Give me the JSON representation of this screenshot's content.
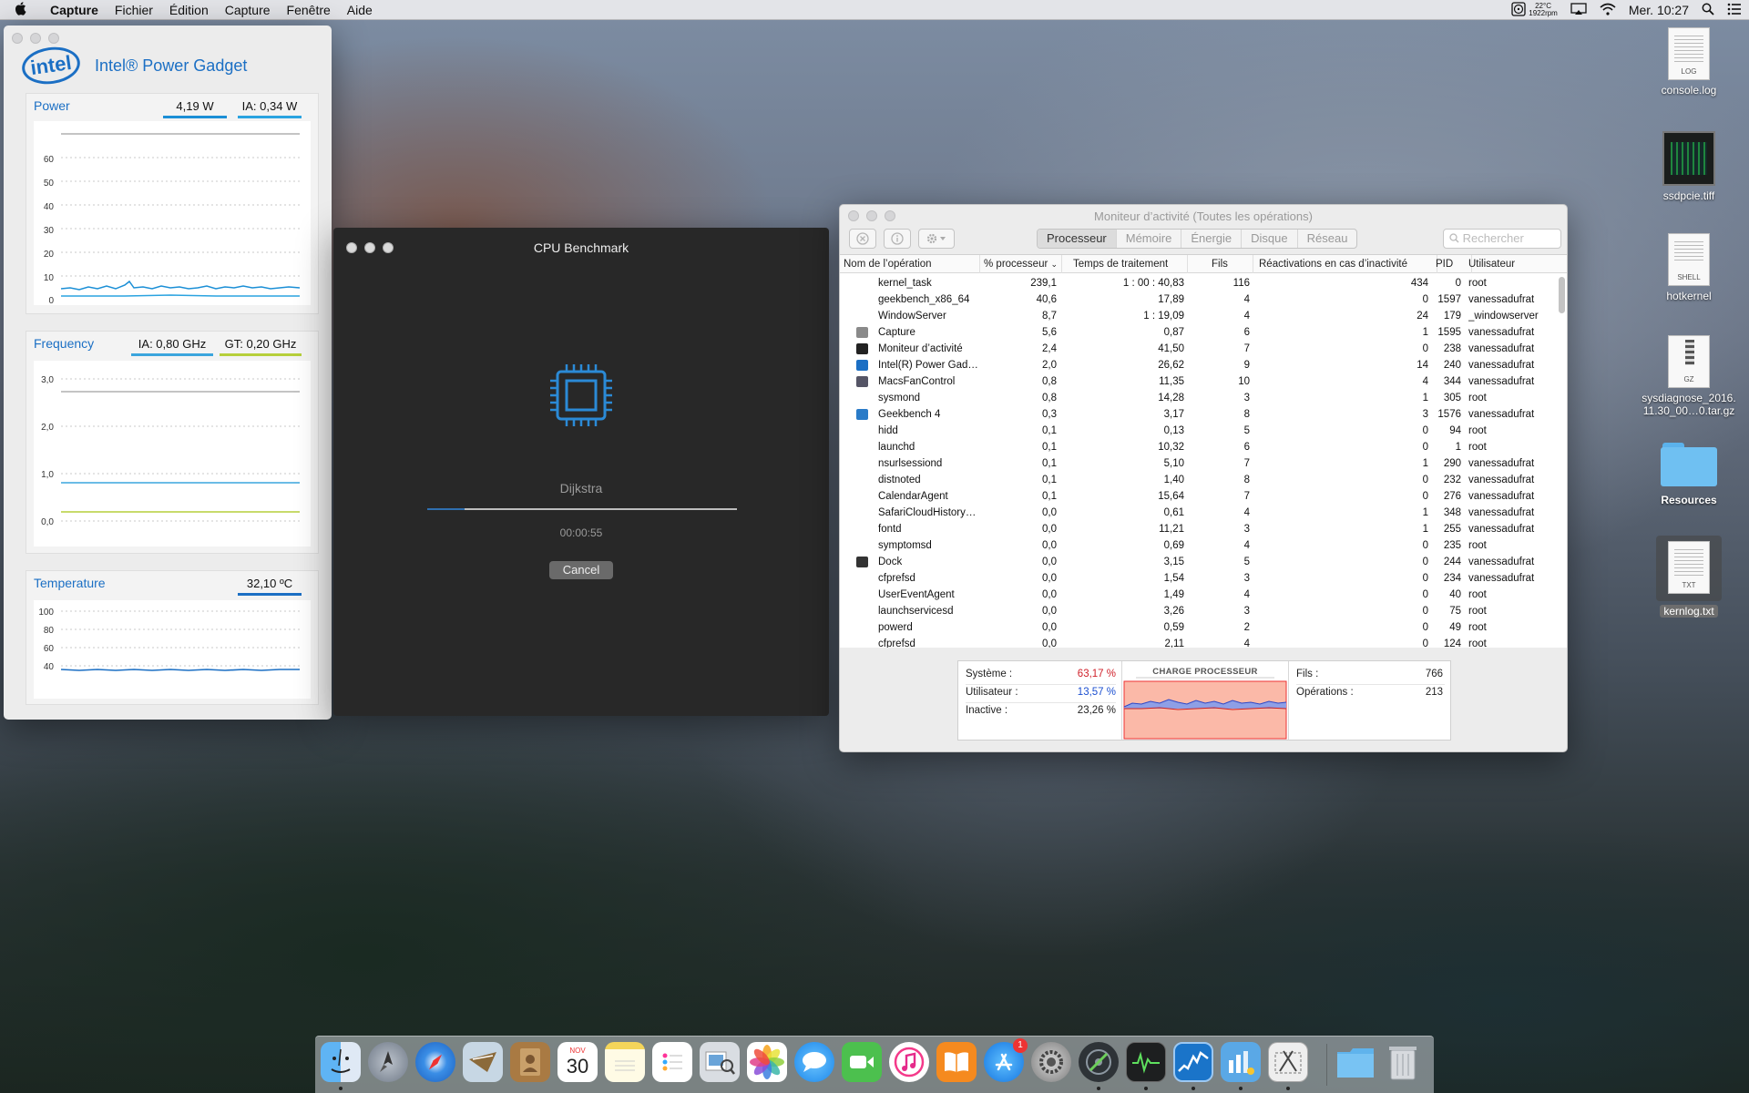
{
  "menubar": {
    "apple": "",
    "items": [
      "Capture",
      "Fichier",
      "Édition",
      "Capture",
      "Fenêtre",
      "Aide"
    ],
    "fan_temp": "22°C",
    "fan_rpm": "1922rpm",
    "clock": "Mer. 10:27"
  },
  "power_gadget": {
    "title": "Intel® Power Gadget",
    "logo": "intel",
    "power": {
      "label": "Power",
      "value1": "4,19 W",
      "value2": "IA: 0,34 W",
      "y_ticks": [
        "60",
        "50",
        "40",
        "30",
        "20",
        "10",
        "0"
      ],
      "series1_color": "#1b8fd6",
      "series2_color": "#2aa3e0"
    },
    "frequency": {
      "label": "Frequency",
      "value1": "IA: 0,80 GHz",
      "value2": "GT: 0,20 GHz",
      "y_ticks": [
        "3,0",
        "2,0",
        "1,0",
        "0,0"
      ],
      "ia_color": "#3aa5dd",
      "gt_color": "#b6cf3a"
    },
    "temperature": {
      "label": "Temperature",
      "value": "32,10 ºC",
      "y_ticks": [
        "100",
        "80",
        "60",
        "40"
      ],
      "series_color": "#1b6fc4"
    }
  },
  "benchmark": {
    "title": "CPU Benchmark",
    "task": "Dijkstra",
    "progress": 0.12,
    "elapsed": "00:00:55",
    "cancel": "Cancel"
  },
  "activity_monitor": {
    "title": "Moniteur d’activité (Toutes les opérations)",
    "tabs": [
      "Processeur",
      "Mémoire",
      "Énergie",
      "Disque",
      "Réseau"
    ],
    "active_tab": "Processeur",
    "search_placeholder": "Rechercher",
    "columns": [
      "Nom de l’opération",
      "% processeur",
      "Temps de traitement",
      "Fils",
      "Réactivations en cas d’inactivité",
      "PID",
      "Utilisateur"
    ],
    "rows": [
      {
        "name": "kernel_task",
        "cpu": "239,1",
        "time": "1 : 00 : 40,83",
        "threads": "116",
        "wakes": "434",
        "pid": "0",
        "user": "root",
        "icon": ""
      },
      {
        "name": "geekbench_x86_64",
        "cpu": "40,6",
        "time": "17,89",
        "threads": "4",
        "wakes": "0",
        "pid": "1597",
        "user": "vanessadufrat",
        "icon": ""
      },
      {
        "name": "WindowServer",
        "cpu": "8,7",
        "time": "1 : 19,09",
        "threads": "4",
        "wakes": "24",
        "pid": "179",
        "user": "_windowserver",
        "icon": ""
      },
      {
        "name": "Capture",
        "cpu": "5,6",
        "time": "0,87",
        "threads": "6",
        "wakes": "1",
        "pid": "1595",
        "user": "vanessadufrat",
        "icon": "#8a8a8a"
      },
      {
        "name": "Moniteur d’activité",
        "cpu": "2,4",
        "time": "41,50",
        "threads": "7",
        "wakes": "0",
        "pid": "238",
        "user": "vanessadufrat",
        "icon": "#222"
      },
      {
        "name": "Intel(R) Power Gad…",
        "cpu": "2,0",
        "time": "26,62",
        "threads": "9",
        "wakes": "14",
        "pid": "240",
        "user": "vanessadufrat",
        "icon": "#1b6fc4"
      },
      {
        "name": "MacsFanControl",
        "cpu": "0,8",
        "time": "11,35",
        "threads": "10",
        "wakes": "4",
        "pid": "344",
        "user": "vanessadufrat",
        "icon": "#556"
      },
      {
        "name": "sysmond",
        "cpu": "0,8",
        "time": "14,28",
        "threads": "3",
        "wakes": "1",
        "pid": "305",
        "user": "root",
        "icon": ""
      },
      {
        "name": "Geekbench 4",
        "cpu": "0,3",
        "time": "3,17",
        "threads": "8",
        "wakes": "3",
        "pid": "1576",
        "user": "vanessadufrat",
        "icon": "#2a7bc8"
      },
      {
        "name": "hidd",
        "cpu": "0,1",
        "time": "0,13",
        "threads": "5",
        "wakes": "0",
        "pid": "94",
        "user": "root",
        "icon": ""
      },
      {
        "name": "launchd",
        "cpu": "0,1",
        "time": "10,32",
        "threads": "6",
        "wakes": "0",
        "pid": "1",
        "user": "root",
        "icon": ""
      },
      {
        "name": "nsurlsessiond",
        "cpu": "0,1",
        "time": "5,10",
        "threads": "7",
        "wakes": "1",
        "pid": "290",
        "user": "vanessadufrat",
        "icon": ""
      },
      {
        "name": "distnoted",
        "cpu": "0,1",
        "time": "1,40",
        "threads": "8",
        "wakes": "0",
        "pid": "232",
        "user": "vanessadufrat",
        "icon": ""
      },
      {
        "name": "CalendarAgent",
        "cpu": "0,1",
        "time": "15,64",
        "threads": "7",
        "wakes": "0",
        "pid": "276",
        "user": "vanessadufrat",
        "icon": ""
      },
      {
        "name": "SafariCloudHistory…",
        "cpu": "0,0",
        "time": "0,61",
        "threads": "4",
        "wakes": "1",
        "pid": "348",
        "user": "vanessadufrat",
        "icon": ""
      },
      {
        "name": "fontd",
        "cpu": "0,0",
        "time": "11,21",
        "threads": "3",
        "wakes": "1",
        "pid": "255",
        "user": "vanessadufrat",
        "icon": ""
      },
      {
        "name": "symptomsd",
        "cpu": "0,0",
        "time": "0,69",
        "threads": "4",
        "wakes": "0",
        "pid": "235",
        "user": "root",
        "icon": ""
      },
      {
        "name": "Dock",
        "cpu": "0,0",
        "time": "3,15",
        "threads": "5",
        "wakes": "0",
        "pid": "244",
        "user": "vanessadufrat",
        "icon": "#333"
      },
      {
        "name": "cfprefsd",
        "cpu": "0,0",
        "time": "1,54",
        "threads": "3",
        "wakes": "0",
        "pid": "234",
        "user": "vanessadufrat",
        "icon": ""
      },
      {
        "name": "UserEventAgent",
        "cpu": "0,0",
        "time": "1,49",
        "threads": "4",
        "wakes": "0",
        "pid": "40",
        "user": "root",
        "icon": ""
      },
      {
        "name": "launchservicesd",
        "cpu": "0,0",
        "time": "3,26",
        "threads": "3",
        "wakes": "0",
        "pid": "75",
        "user": "root",
        "icon": ""
      },
      {
        "name": "powerd",
        "cpu": "0,0",
        "time": "0,59",
        "threads": "2",
        "wakes": "0",
        "pid": "49",
        "user": "root",
        "icon": ""
      },
      {
        "name": "cfprefsd",
        "cpu": "0,0",
        "time": "2,11",
        "threads": "4",
        "wakes": "0",
        "pid": "124",
        "user": "root",
        "icon": ""
      }
    ],
    "summary": {
      "system_label": "Système :",
      "system_value": "63,17 %",
      "system_color": "#d0202a",
      "user_label": "Utilisateur :",
      "user_value": "13,57 %",
      "user_color": "#1b4fd0",
      "idle_label": "Inactive :",
      "idle_value": "23,26 %",
      "chart_title": "CHARGE PROCESSEUR",
      "threads_label": "Fils :",
      "threads_value": "766",
      "processes_label": "Opérations :",
      "processes_value": "213"
    }
  },
  "desktop": {
    "icons": [
      {
        "label": "console.log",
        "ext": "LOG",
        "kind": "doc"
      },
      {
        "label": "ssdpcie.tiff",
        "ext": "",
        "kind": "image"
      },
      {
        "label": "hotkernel",
        "ext": "SHELL",
        "kind": "doc"
      },
      {
        "label": "sysdiagnose_2016.\n11.30_00…0.tar.gz",
        "ext": "GZ",
        "kind": "doc"
      },
      {
        "label": "Resources",
        "ext": "",
        "kind": "folder"
      },
      {
        "label": "kernlog.txt",
        "ext": "TXT",
        "kind": "doc"
      }
    ]
  },
  "dock": {
    "calendar_month": "NOV",
    "calendar_day": "30",
    "appstore_badge": "1"
  }
}
